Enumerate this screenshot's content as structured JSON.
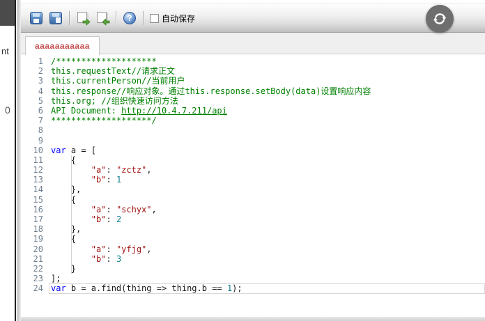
{
  "background_window": {
    "fragment_top": "nt",
    "fragment_bottom": "0"
  },
  "toolbar": {
    "autosave_label": "自动保存",
    "autosave_checked": false,
    "icons": [
      "save-icon",
      "save-as-icon",
      "export-icon",
      "import-icon",
      "help-icon"
    ]
  },
  "refresh_button": {
    "icon": "refresh-icon"
  },
  "tab": {
    "label": "aaaaaaaaaaa",
    "color": "#c35050"
  },
  "editor": {
    "token_colors": {
      "comment": "#008000",
      "keyword": "#0000ff",
      "string": "#a31515",
      "number": "#0e7f8d",
      "plain": "#1a1a1a",
      "link": "#008000",
      "line_number": "#708090"
    },
    "lines": [
      {
        "n": 1,
        "seg": [
          [
            "comment",
            "/********************"
          ]
        ]
      },
      {
        "n": 2,
        "seg": [
          [
            "comment",
            "this.requestText//请求正文"
          ]
        ]
      },
      {
        "n": 3,
        "seg": [
          [
            "comment",
            "this.currentPerson//当前用户"
          ]
        ]
      },
      {
        "n": 4,
        "seg": [
          [
            "comment",
            "this.response//响应对象。通过this.response.setBody(data)设置响应内容"
          ]
        ]
      },
      {
        "n": 5,
        "seg": [
          [
            "comment",
            "this.org; //组织快速访问方法"
          ]
        ]
      },
      {
        "n": 6,
        "seg": [
          [
            "comment",
            "API Document: "
          ],
          [
            "link",
            "http://10.4.7.211/api"
          ]
        ]
      },
      {
        "n": 7,
        "seg": [
          [
            "comment",
            "********************/"
          ]
        ]
      },
      {
        "n": 8,
        "seg": []
      },
      {
        "n": 9,
        "seg": []
      },
      {
        "n": 10,
        "seg": [
          [
            "keyword",
            "var"
          ],
          [
            "plain",
            " a = ["
          ]
        ]
      },
      {
        "n": 11,
        "seg": [
          [
            "plain",
            "    {"
          ]
        ]
      },
      {
        "n": 12,
        "seg": [
          [
            "plain",
            "        "
          ],
          [
            "string",
            "\"a\""
          ],
          [
            "plain",
            ": "
          ],
          [
            "string",
            "\"zctz\""
          ],
          [
            "plain",
            ","
          ]
        ]
      },
      {
        "n": 13,
        "seg": [
          [
            "plain",
            "        "
          ],
          [
            "string",
            "\"b\""
          ],
          [
            "plain",
            ": "
          ],
          [
            "number",
            "1"
          ]
        ]
      },
      {
        "n": 14,
        "seg": [
          [
            "plain",
            "    },"
          ]
        ]
      },
      {
        "n": 15,
        "seg": [
          [
            "plain",
            "    {"
          ]
        ]
      },
      {
        "n": 16,
        "seg": [
          [
            "plain",
            "        "
          ],
          [
            "string",
            "\"a\""
          ],
          [
            "plain",
            ": "
          ],
          [
            "string",
            "\"schyx\""
          ],
          [
            "plain",
            ","
          ]
        ]
      },
      {
        "n": 17,
        "seg": [
          [
            "plain",
            "        "
          ],
          [
            "string",
            "\"b\""
          ],
          [
            "plain",
            ": "
          ],
          [
            "number",
            "2"
          ]
        ]
      },
      {
        "n": 18,
        "seg": [
          [
            "plain",
            "    },"
          ]
        ]
      },
      {
        "n": 19,
        "seg": [
          [
            "plain",
            "    {"
          ]
        ]
      },
      {
        "n": 20,
        "seg": [
          [
            "plain",
            "        "
          ],
          [
            "string",
            "\"a\""
          ],
          [
            "plain",
            ": "
          ],
          [
            "string",
            "\"yfjg\""
          ],
          [
            "plain",
            ","
          ]
        ]
      },
      {
        "n": 21,
        "seg": [
          [
            "plain",
            "        "
          ],
          [
            "string",
            "\"b\""
          ],
          [
            "plain",
            ": "
          ],
          [
            "number",
            "3"
          ]
        ]
      },
      {
        "n": 22,
        "seg": [
          [
            "plain",
            "    }"
          ]
        ]
      },
      {
        "n": 23,
        "seg": [
          [
            "plain",
            "];"
          ]
        ]
      },
      {
        "n": 24,
        "seg": [
          [
            "keyword",
            "var"
          ],
          [
            "plain",
            " b = a.find(thing => thing.b == "
          ],
          [
            "number",
            "1"
          ],
          [
            "plain",
            ");"
          ]
        ],
        "cur": true
      }
    ],
    "indent_guide": {
      "from_line": 11,
      "to_line": 22,
      "column": 4
    }
  }
}
